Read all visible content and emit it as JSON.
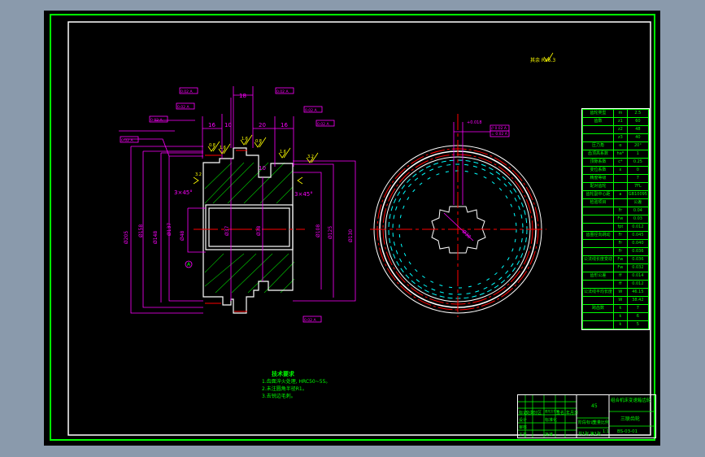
{
  "drawing": {
    "roughness_global": "其余 Ra6.3",
    "dimensions_top": [
      "18",
      "16",
      "10",
      "20",
      "16"
    ],
    "dimension_groove": "10",
    "diameters_left": [
      "Ø205",
      "Ø158",
      "Ø148",
      "Ø137",
      "Ø48"
    ],
    "diameters_center": [
      "Ø37",
      "Ø38"
    ],
    "diameters_right": [
      "Ø108",
      "Ø125",
      "Ø130"
    ],
    "chamfer_left": "3×45°",
    "chamfer_right": "3×45°",
    "roughness_marks": [
      "0.8",
      "1.6",
      "1.6",
      "0.8",
      "1.6",
      "3.2",
      "3.2"
    ],
    "tolerance_frames": [
      "0.02 A",
      "0.02 A",
      "0.02 A",
      "0.02 A",
      "0.02 A",
      "0.02 A",
      "0.02 A",
      "0.02 A"
    ],
    "datum_label": "A",
    "side_view": {
      "spline_label": "Ø38",
      "keyway_tolerance": "+0.018",
      "frames": [
        "// 0.02 A",
        "⊥ 0.02 A"
      ]
    }
  },
  "tech_requirements": {
    "title": "技术要求",
    "items": [
      "1.齿面淬火处理, HRC50~55。",
      "2.未注圆角半径R1。",
      "3.去锐边毛刺。"
    ]
  },
  "param_table": {
    "rows": [
      [
        "齿轮类型",
        "m",
        "2.5"
      ],
      [
        "齿数",
        "z1",
        "60"
      ],
      [
        "",
        "z2",
        "48"
      ],
      [
        "",
        "z3",
        "40"
      ],
      [
        "压力角",
        "α",
        "20°"
      ],
      [
        "齿顶高系数",
        "ha*",
        "1"
      ],
      [
        "顶隙系数",
        "c*",
        "0.25"
      ],
      [
        "变位系数",
        "x",
        "0"
      ],
      [
        "精度等级",
        "",
        "7"
      ],
      [
        "配对齿轮",
        "",
        "7FL"
      ],
      [
        "齿轮副中心距",
        "a",
        "GB10095"
      ],
      [
        "检验项目",
        "",
        "公差"
      ],
      [
        "",
        "Fr",
        "0.04"
      ],
      [
        "",
        "Fw",
        "0.03"
      ],
      [
        "",
        "fpt",
        "0.012"
      ],
      [
        "齿圈径向跳动",
        "Fr",
        "0.045"
      ],
      [
        "",
        "Fr",
        "0.040"
      ],
      [
        "",
        "Fr",
        "0.036"
      ],
      [
        "公法线长度变动",
        "Fw",
        "0.036"
      ],
      [
        "",
        "Fw",
        "0.032"
      ],
      [
        "齿形公差",
        "ff",
        "0.014"
      ],
      [
        "",
        "ff",
        "0.012"
      ],
      [
        "公法线平均长度",
        "W",
        "46.15"
      ],
      [
        "",
        "W",
        "38.42"
      ],
      [
        "跨齿数",
        "k",
        "7"
      ],
      [
        "",
        "k",
        "6"
      ],
      [
        "",
        "k",
        "5"
      ]
    ]
  },
  "title_block": {
    "title": "组合机床变速箱齿轮",
    "part": "三联齿轮",
    "material": "45",
    "scale": "1:1",
    "sheet": "共1张 第1张",
    "drawing_no": "BS-03-01",
    "labels": [
      "标记",
      "处数",
      "分区",
      "更改文件号",
      "签名",
      "年月日",
      "设计",
      "标准化",
      "审核",
      "工艺",
      "批准",
      "阶段标记",
      "重量",
      "比例"
    ]
  }
}
